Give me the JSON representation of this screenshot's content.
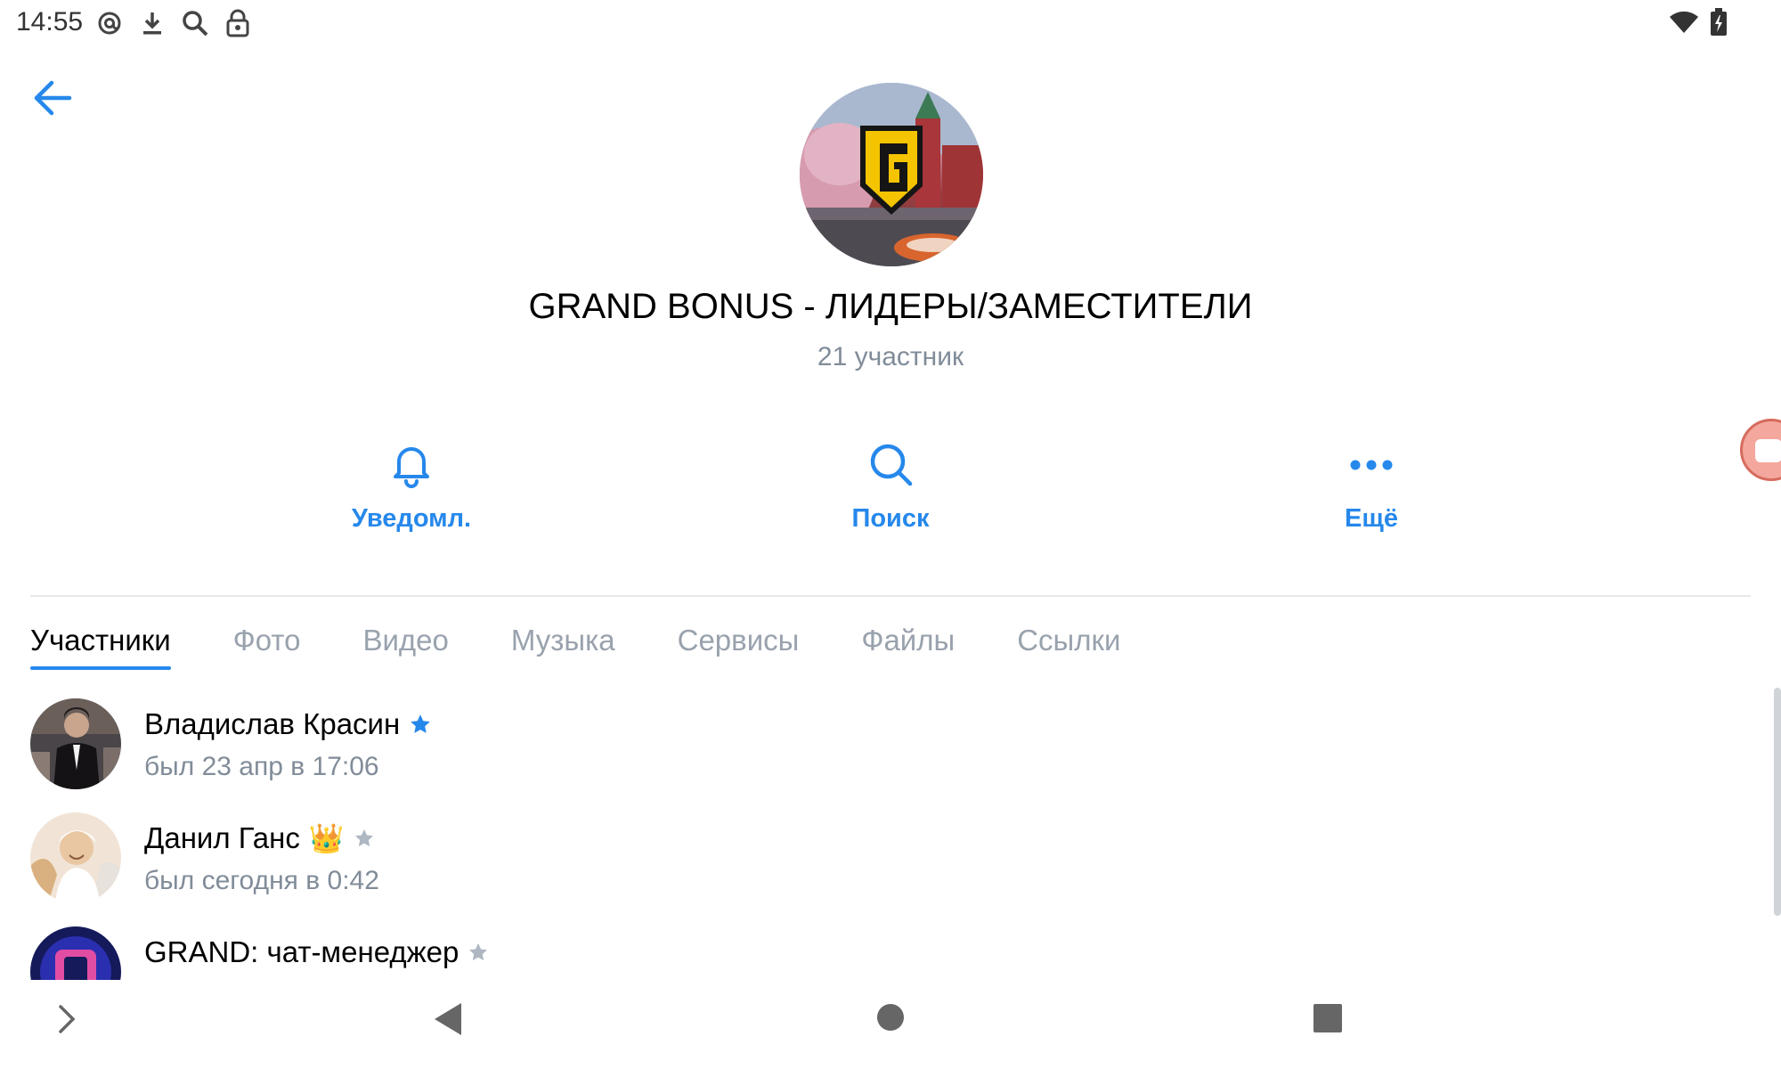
{
  "status_bar": {
    "time": "14:55",
    "left_icons": [
      "at-icon",
      "download-icon",
      "search-icon",
      "lock-icon"
    ],
    "right_icons": [
      "wifi-icon",
      "battery-icon"
    ]
  },
  "header": {
    "back_icon": "arrow-left-icon",
    "title": "GRAND BONUS - ЛИДЕРЫ/ЗАМЕСТИТЕЛИ",
    "subtitle": "21 участник"
  },
  "actions": [
    {
      "label": "Уведомл.",
      "icon": "bell-icon"
    },
    {
      "label": "Поиск",
      "icon": "search-icon"
    },
    {
      "label": "Ещё",
      "icon": "more-icon"
    }
  ],
  "tabs": [
    {
      "label": "Участники",
      "active": true
    },
    {
      "label": "Фото",
      "active": false
    },
    {
      "label": "Видео",
      "active": false
    },
    {
      "label": "Музыка",
      "active": false
    },
    {
      "label": "Сервисы",
      "active": false
    },
    {
      "label": "Файлы",
      "active": false
    },
    {
      "label": "Ссылки",
      "active": false
    }
  ],
  "members": [
    {
      "name": "Владислав Красин",
      "status": "был 23 апр в 17:06",
      "star": "blue"
    },
    {
      "name": "Данил Ганс",
      "emoji": "👑",
      "status": "был сегодня в 0:42",
      "star": "gray"
    },
    {
      "name": "GRAND: чат-менеджер",
      "status": "",
      "star": "gray"
    }
  ],
  "nav_bar": {
    "icons": [
      "chevron-right-icon",
      "back-triangle-icon",
      "home-circle-icon",
      "recents-square-icon"
    ]
  },
  "colors": {
    "accent": "#2688eb",
    "secondary_text": "#818c99",
    "tab_inactive": "#99a2ad",
    "divider": "#e7e8ec",
    "logo_yellow": "#f5c400"
  }
}
